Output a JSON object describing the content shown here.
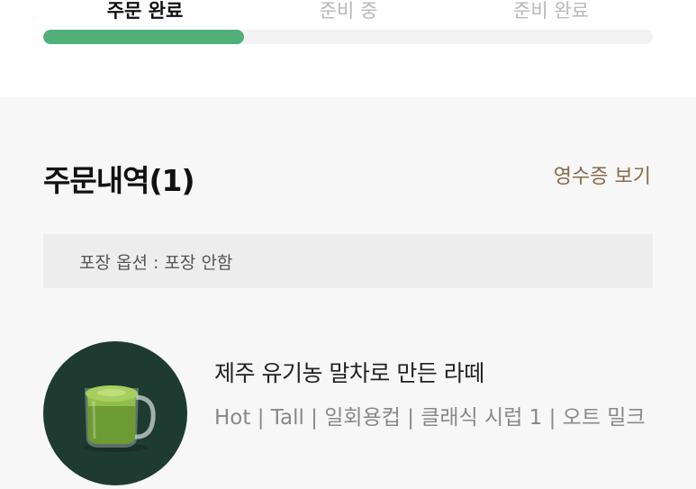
{
  "steps": [
    {
      "label": "주문 완료",
      "active": true
    },
    {
      "label": "준비 중",
      "active": false
    },
    {
      "label": "준비 완료",
      "active": false
    }
  ],
  "progress_percent": 33,
  "colors": {
    "progress": "#4fb07b",
    "link": "#8b6a4a",
    "thumb_bg": "#1e3b31"
  },
  "order": {
    "title": "주문내역(1)",
    "receipt_link": "영수증 보기",
    "packing_option": "포장 옵션 : 포장 안함"
  },
  "item": {
    "name": "제주 유기농 말차로 만든 라떼",
    "options": "Hot | Tall | 일회용컵 | 클래식 시럽 1 | 오트 밀크",
    "image_icon": "matcha-latte-mug-icon"
  }
}
